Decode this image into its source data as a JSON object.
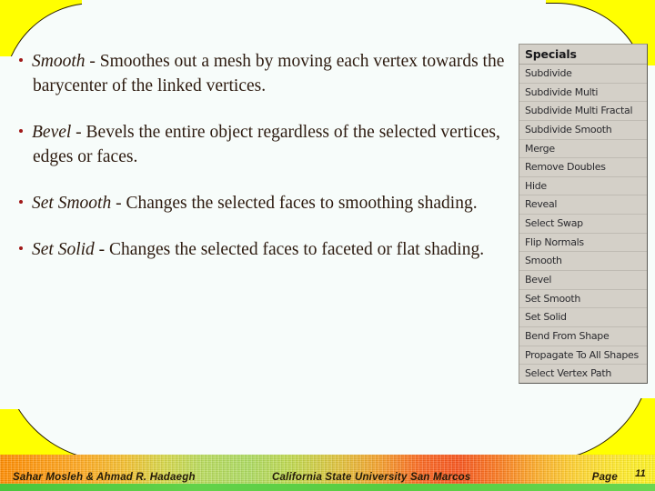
{
  "slide": {
    "background_color": "#f7fcfa",
    "accent_color": "#ffff00",
    "bullet_color": "#a01818",
    "bullets": [
      {
        "term": "Smooth",
        "dash": " - ",
        "description": "Smoothes out a mesh by moving each vertex towards the barycenter of the linked vertices."
      },
      {
        "term": "Bevel",
        "dash": " - ",
        "description": "Bevels the entire object regardless of the selected vertices, edges or faces."
      },
      {
        "term": "Set Smooth",
        "dash": " - ",
        "description": "Changes the selected faces to smoothing shading."
      },
      {
        "term": "Set Solid",
        "dash": " - ",
        "description": "Changes the selected faces to faceted or flat shading."
      }
    ]
  },
  "specials_menu": {
    "title": "Specials",
    "items": [
      "Subdivide",
      "Subdivide Multi",
      "Subdivide Multi Fractal",
      "Subdivide Smooth",
      "Merge",
      "Remove Doubles",
      "Hide",
      "Reveal",
      "Select Swap",
      "Flip Normals",
      "Smooth",
      "Bevel",
      "Set Smooth",
      "Set Solid",
      "Bend From Shape",
      "Propagate To All Shapes",
      "Select Vertex Path"
    ]
  },
  "footer": {
    "authors": "Sahar Mosleh & Ahmad R. Hadaegh",
    "institution": "California State University San Marcos",
    "page_label": "Page",
    "page_number": "11"
  }
}
